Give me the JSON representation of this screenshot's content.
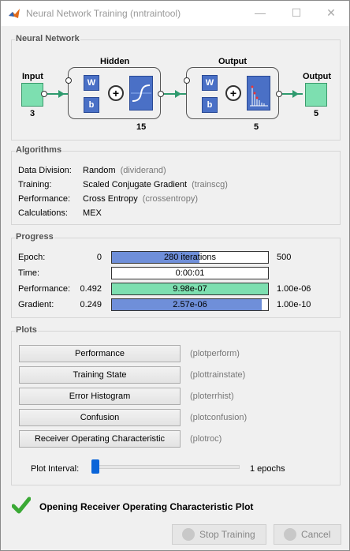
{
  "window": {
    "title": "Neural Network Training (nntraintool)",
    "minimize": "—",
    "maximize": "☐",
    "close": "✕"
  },
  "network": {
    "section_title": "Neural Network",
    "input_label": "Input",
    "input_size": "3",
    "hidden_label": "Hidden",
    "hidden_size": "15",
    "output_layer_label": "Output",
    "output_layer_size": "5",
    "output_label": "Output",
    "output_size": "5",
    "w": "W",
    "b": "b",
    "plus": "+"
  },
  "algorithms": {
    "section_title": "Algorithms",
    "rows": [
      {
        "label": "Data Division:",
        "value": "Random",
        "fn": "(dividerand)"
      },
      {
        "label": "Training:",
        "value": "Scaled Conjugate Gradient",
        "fn": "(trainscg)"
      },
      {
        "label": "Performance:",
        "value": "Cross Entropy",
        "fn": "(crossentropy)"
      },
      {
        "label": "Calculations:",
        "value": "MEX",
        "fn": ""
      }
    ]
  },
  "progress": {
    "section_title": "Progress",
    "rows": [
      {
        "label": "Epoch:",
        "start": "0",
        "bar_text": "280 iterations",
        "end": "500",
        "fill_fraction": 0.56,
        "fill_color": "#6f8fd9"
      },
      {
        "label": "Time:",
        "start": "",
        "bar_text": "0:00:01",
        "end": "",
        "fill_fraction": 0,
        "fill_color": "#ffffff"
      },
      {
        "label": "Performance:",
        "start": "0.492",
        "bar_text": "9.98e-07",
        "end": "1.00e-06",
        "fill_fraction": 1.0,
        "fill_color": "#7ddfb0"
      },
      {
        "label": "Gradient:",
        "start": "0.249",
        "bar_text": "2.57e-06",
        "end": "1.00e-10",
        "fill_fraction": 0.96,
        "fill_color": "#6f8fd9"
      }
    ]
  },
  "plots": {
    "section_title": "Plots",
    "buttons": [
      {
        "label": "Performance",
        "fn": "(plotperform)"
      },
      {
        "label": "Training State",
        "fn": "(plottrainstate)"
      },
      {
        "label": "Error Histogram",
        "fn": "(ploterrhist)"
      },
      {
        "label": "Confusion",
        "fn": "(plotconfusion)"
      },
      {
        "label": "Receiver Operating Characteristic",
        "fn": "(plotroc)"
      }
    ],
    "interval_label": "Plot Interval:",
    "interval_value": "1 epochs",
    "interval_fraction": 0.0
  },
  "status": {
    "message": "Opening Receiver Operating Characteristic Plot",
    "icon": "checkmark-icon"
  },
  "footer": {
    "stop_label": "Stop Training",
    "cancel_label": "Cancel"
  }
}
